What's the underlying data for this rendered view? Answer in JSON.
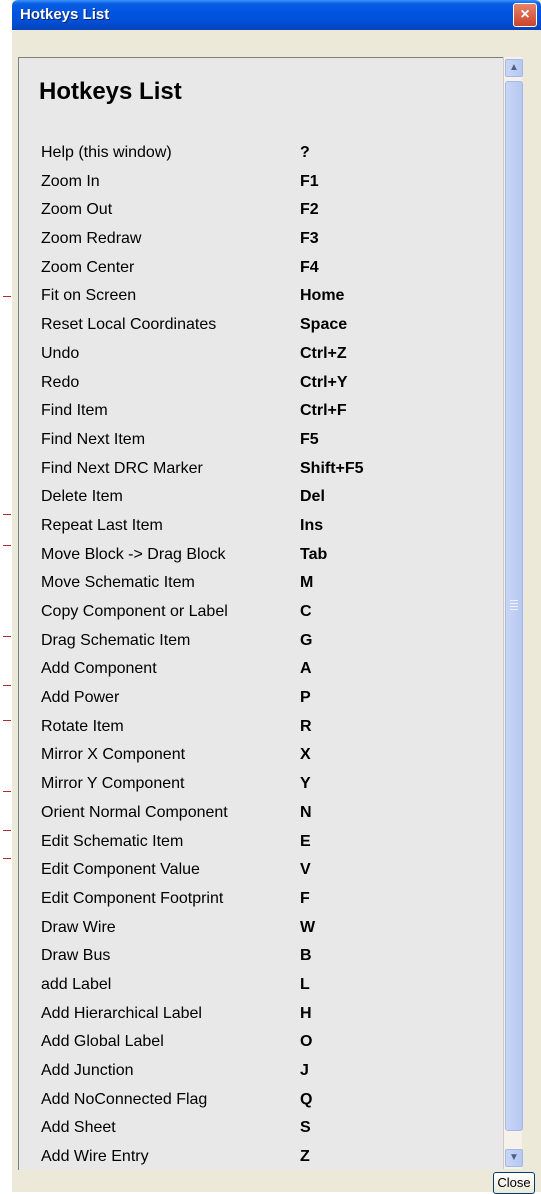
{
  "window": {
    "title": "Hotkeys List",
    "close_icon": "×",
    "close_button": "Close"
  },
  "content": {
    "heading": "Hotkeys List",
    "hotkeys": [
      {
        "action": "Help (this window)",
        "key": "?"
      },
      {
        "action": "Zoom In",
        "key": "F1"
      },
      {
        "action": "Zoom Out",
        "key": "F2"
      },
      {
        "action": "Zoom Redraw",
        "key": "F3"
      },
      {
        "action": "Zoom Center",
        "key": "F4"
      },
      {
        "action": "Fit on Screen",
        "key": "Home"
      },
      {
        "action": "Reset Local Coordinates",
        "key": "Space"
      },
      {
        "action": "Undo",
        "key": "Ctrl+Z"
      },
      {
        "action": "Redo",
        "key": "Ctrl+Y"
      },
      {
        "action": "Find Item",
        "key": "Ctrl+F"
      },
      {
        "action": "Find Next Item",
        "key": "F5"
      },
      {
        "action": "Find Next DRC Marker",
        "key": "Shift+F5"
      },
      {
        "action": "Delete Item",
        "key": "Del"
      },
      {
        "action": "Repeat Last Item",
        "key": "Ins"
      },
      {
        "action": "Move Block -> Drag Block",
        "key": "Tab"
      },
      {
        "action": "Move Schematic Item",
        "key": "M"
      },
      {
        "action": "Copy Component or Label",
        "key": "C"
      },
      {
        "action": "Drag Schematic Item",
        "key": "G"
      },
      {
        "action": "Add Component",
        "key": "A"
      },
      {
        "action": "Add Power",
        "key": "P"
      },
      {
        "action": "Rotate Item",
        "key": "R"
      },
      {
        "action": "Mirror X Component",
        "key": "X"
      },
      {
        "action": "Mirror Y Component",
        "key": "Y"
      },
      {
        "action": "Orient Normal Component",
        "key": "N"
      },
      {
        "action": "Edit Schematic Item",
        "key": "E"
      },
      {
        "action": "Edit Component Value",
        "key": "V"
      },
      {
        "action": "Edit Component Footprint",
        "key": "F"
      },
      {
        "action": "Draw Wire",
        "key": "W"
      },
      {
        "action": "Draw Bus",
        "key": "B"
      },
      {
        "action": "add Label",
        "key": "L"
      },
      {
        "action": "Add Hierarchical Label",
        "key": "H"
      },
      {
        "action": "Add Global Label",
        "key": "O"
      },
      {
        "action": "Add Junction",
        "key": "J"
      },
      {
        "action": "Add NoConnected Flag",
        "key": "Q"
      },
      {
        "action": "Add Sheet",
        "key": "S"
      },
      {
        "action": "Add Wire Entry",
        "key": "Z"
      }
    ]
  },
  "scrollbar": {
    "up_icon": "▲",
    "down_icon": "▼"
  },
  "colors": {
    "titlebar": "#0054e3",
    "close": "#c8452b",
    "panel": "#e8e8e8",
    "frame": "#ece9d8"
  }
}
